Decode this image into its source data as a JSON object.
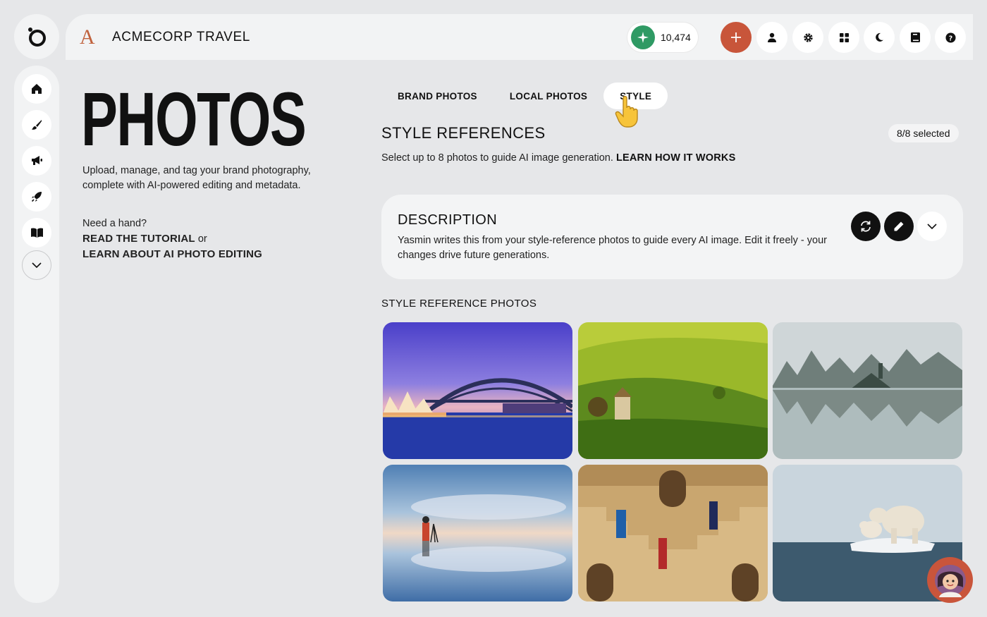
{
  "app": {
    "logo_icon": "brand-ring-icon"
  },
  "header": {
    "brand_mark": "A",
    "brand_name": "ACMECORP TRAVEL",
    "credits": "10,474",
    "buttons": [
      "add-icon",
      "user-icon",
      "settings-icon",
      "grid-icon",
      "moon-icon",
      "book-icon",
      "help-icon"
    ]
  },
  "sidebar": {
    "items": [
      "home-icon",
      "brush-icon",
      "megaphone-icon",
      "rocket-icon",
      "book-open-icon",
      "chevron-down-icon"
    ]
  },
  "page": {
    "title": "PHOTOS",
    "intro": "Upload, manage, and tag your brand photography, complete with AI-powered editing and metadata.",
    "help_lead": "Need a hand?",
    "help_link1": "READ THE TUTORIAL",
    "help_or": " or",
    "help_link2": "LEARN ABOUT AI PHOTO EDITING"
  },
  "tabs": [
    {
      "label": "BRAND PHOTOS",
      "active": false
    },
    {
      "label": "LOCAL PHOTOS",
      "active": false
    },
    {
      "label": "STYLE",
      "active": true
    }
  ],
  "style_refs": {
    "title": "STYLE REFERENCES",
    "selected": "8/8 selected",
    "subtitle": "Select up to 8 photos to guide AI image generation.",
    "learn_link": "LEARN HOW IT WORKS"
  },
  "description": {
    "title": "DESCRIPTION",
    "text": "Yasmin writes this from your style-reference photos to guide every AI image. Edit it freely - your changes drive future generations."
  },
  "photos": {
    "title": "STYLE REFERENCE PHOTOS",
    "items": [
      "sydney-opera-house",
      "green-hills-windmill",
      "karst-lake-reflection",
      "photographer-salt-flat",
      "stepwell-women",
      "polar-bears-ice"
    ]
  },
  "colors": {
    "accent": "#c8553a",
    "credit": "#2f9a64",
    "bg": "#e6e7e9"
  }
}
